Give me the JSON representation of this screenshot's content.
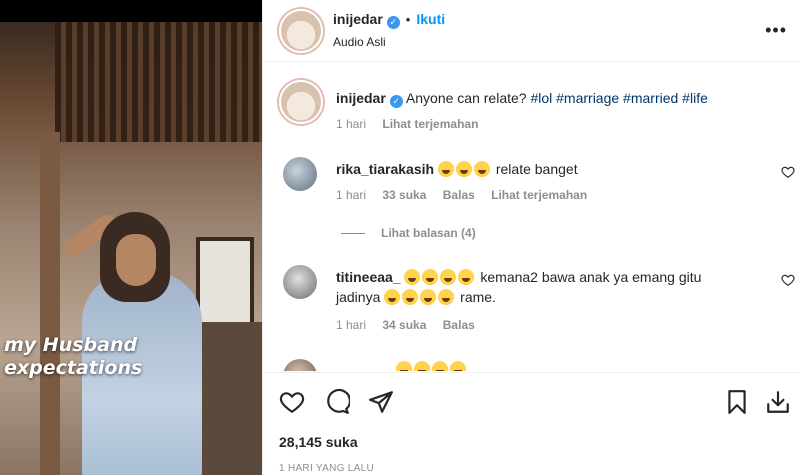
{
  "video": {
    "overlay_line1": "my Husband",
    "overlay_line2": "expectations"
  },
  "post": {
    "username": "inijedar",
    "dot": "•",
    "follow_label": "Ikuti",
    "audio": "Audio Asli",
    "more_icon": "more-horizontal-icon"
  },
  "caption": {
    "username": "inijedar",
    "text": "Anyone can relate?",
    "hashtags": "#lol #marriage #married #life",
    "time": "1 hari",
    "translate": "Lihat terjemahan"
  },
  "comments": [
    {
      "username": "rika_tiarakasih",
      "text": "relate banget",
      "emoji_count_before": 3,
      "time": "1 hari",
      "likes": "33 suka",
      "reply": "Balas",
      "translate": "Lihat terjemahan",
      "view_replies": "Lihat balasan (4)"
    },
    {
      "username": "titineeaa_",
      "text_part1": "kemana2 bawa anak ya emang gitu",
      "text_part2_prefix": "jadinya",
      "text_part2_suffix": "rame.",
      "time": "1 hari",
      "likes": "34 suka",
      "reply": "Balas"
    }
  ],
  "footer": {
    "likes": "28,145 suka",
    "timestamp": "1 HARI YANG LALU"
  },
  "colors": {
    "accent": "#0095f6",
    "verified": "#3897f0",
    "text": "#262626",
    "muted": "#8e8e8e",
    "hashtag": "#00376b"
  }
}
